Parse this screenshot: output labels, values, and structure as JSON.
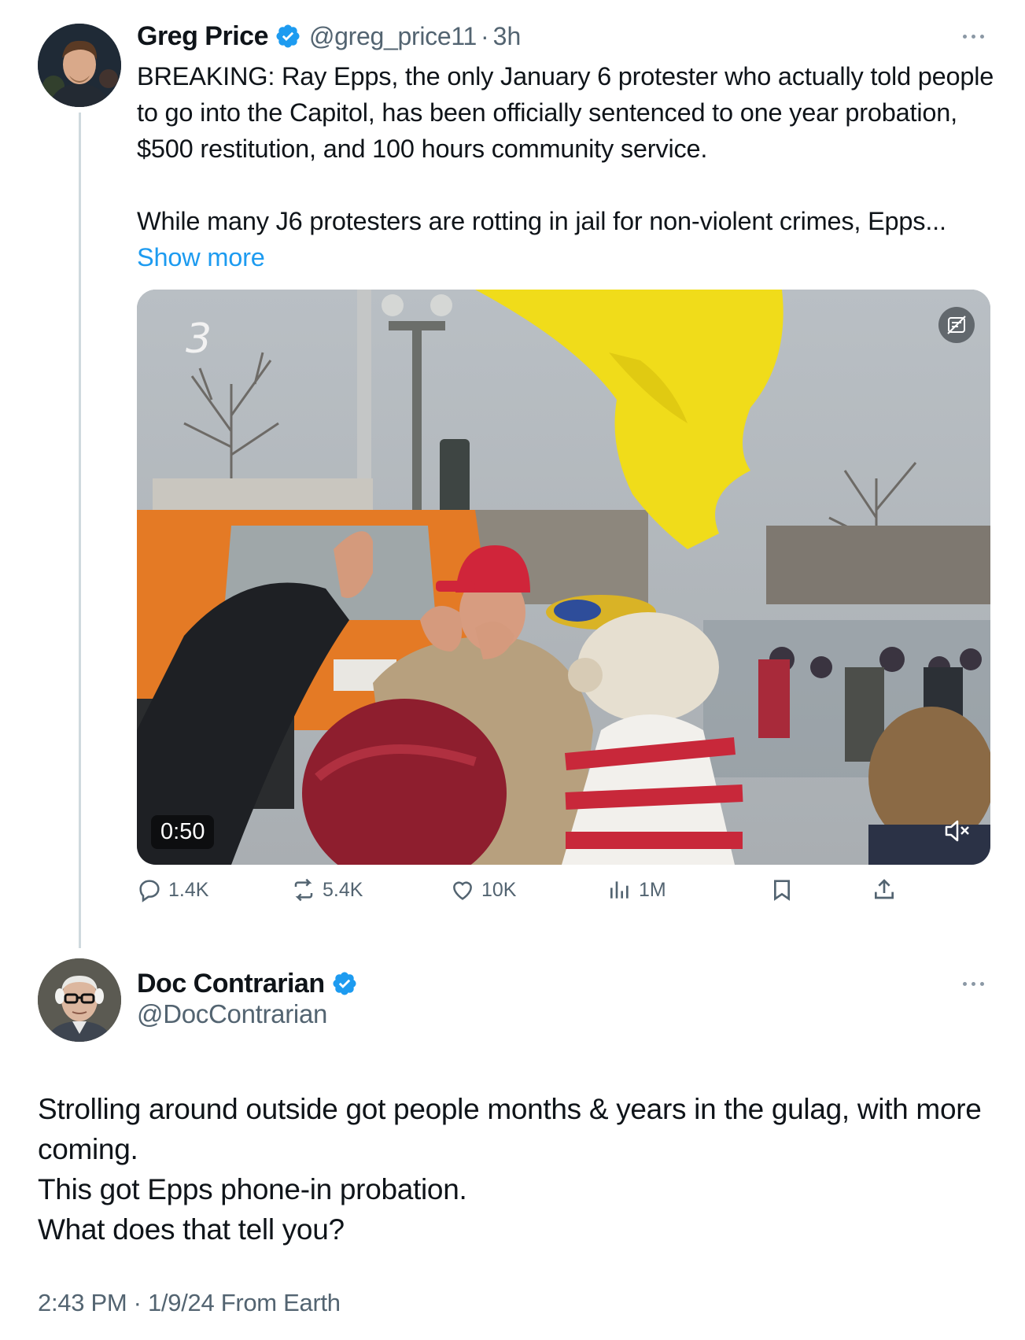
{
  "tweet1": {
    "author_name": "Greg Price",
    "handle": "@greg_price11",
    "separator": "·",
    "time": "3h",
    "paragraphs": [
      "BREAKING: Ray Epps, the only January 6 protester who actually told people to go into the Capitol, has been officially sentenced to one year probation, $500 restitution, and 100 hours community service."
    ],
    "truncated_text": "While many J6 protesters are rotting in jail for non-violent crimes, Epps...",
    "show_more": "Show more",
    "video": {
      "duration": "0:50",
      "overlay_number": "3"
    },
    "stats": {
      "replies": "1.4K",
      "reposts": "5.4K",
      "likes": "10K",
      "views": "1M"
    }
  },
  "tweet2": {
    "author_name": "Doc Contrarian",
    "handle": "@DocContrarian",
    "lines": [
      "Strolling around outside got people months & years in the gulag, with more coming.",
      "This got Epps phone-in probation.",
      "What does that tell you?"
    ],
    "timestamp": "2:43 PM · 1/9/24 From Earth"
  },
  "colors": {
    "link": "#1d9bf0",
    "verified": "#1d9bf0",
    "secondary_text": "#536471",
    "thread_line": "#cfd9de"
  },
  "icons": [
    "verified-badge-icon",
    "more-options-icon",
    "gif-toggle-icon",
    "mute-icon",
    "reply-icon",
    "repost-icon",
    "like-icon",
    "views-icon",
    "bookmark-icon",
    "share-icon"
  ]
}
